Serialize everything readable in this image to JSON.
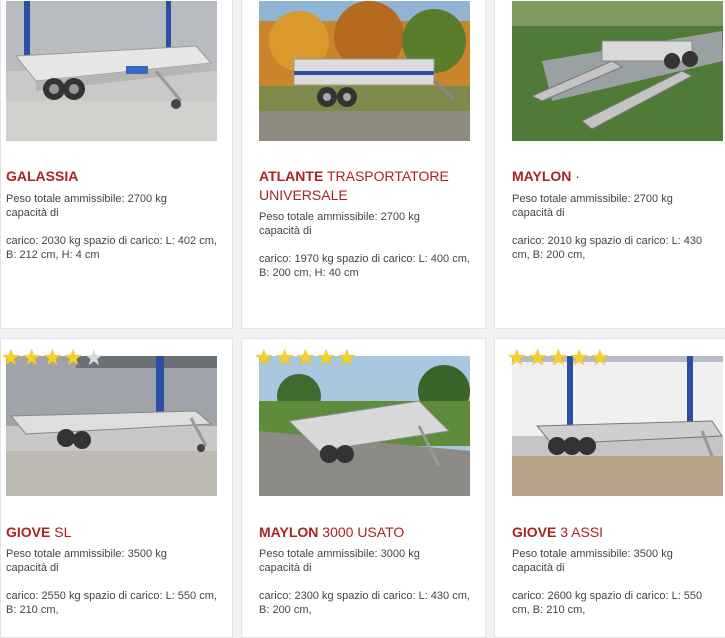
{
  "products": [
    {
      "name_bold": "GALASSIA",
      "name_rest": "",
      "weight": "Peso totale ammissibile: 2700 kg",
      "capacity_label": "capacità di",
      "cargo": "carico: 2030 kg spazio di carico: L: 402 cm, B: 212 cm, H: 4 cm",
      "rating": null
    },
    {
      "name_bold": "ATLANTE",
      "name_rest": "TRASPORTATORE UNIVERSALE",
      "weight": "Peso totale ammissibile: 2700 kg",
      "capacity_label": "capacità di",
      "cargo": "carico: 1970 kg spazio di carico: L: 400 cm, B: 200 cm, H: 40 cm",
      "rating": null
    },
    {
      "name_bold": "MAYLON",
      "name_rest": "·",
      "weight": "Peso totale ammissibile: 2700 kg",
      "capacity_label": "capacità di",
      "cargo": "carico: 2010 kg spazio di carico: L: 430 cm, B: 200 cm,",
      "rating": null
    },
    {
      "name_bold": "GIOVE",
      "name_rest": "SL",
      "weight": "Peso totale ammissibile: 3500 kg",
      "capacity_label": "capacità di",
      "cargo": "carico: 2550 kg spazio di carico: L: 550 cm, B: 210 cm,",
      "rating": 4
    },
    {
      "name_bold": "MAYLON",
      "name_rest": "3000 USATO",
      "weight": "Peso totale ammissibile: 3000 kg",
      "capacity_label": "capacità di",
      "cargo": "carico: 2300 kg spazio di carico: L: 430 cm, B: 200 cm,",
      "rating": 5
    },
    {
      "name_bold": "GIOVE",
      "name_rest": "3 ASSI",
      "weight": "Peso totale ammissibile: 3500 kg",
      "capacity_label": "capacità di",
      "cargo": "carico: 2600 kg spazio di carico: L: 550 cm, B: 210 cm,",
      "rating": 5
    }
  ],
  "colors": {
    "title": "#a92325",
    "star_on": "#f5cf2e",
    "star_off": "#d9d9d9"
  },
  "icons": {
    "rating": "star-icon"
  }
}
